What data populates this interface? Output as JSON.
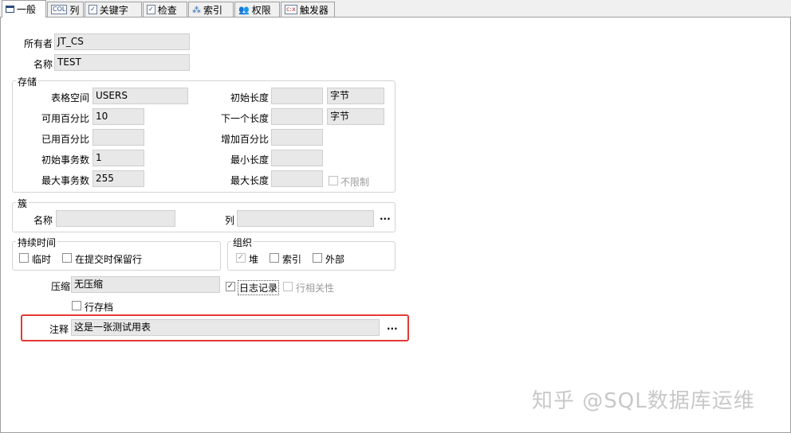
{
  "tabs": [
    {
      "label": "一般",
      "icon": "window-icon"
    },
    {
      "label": "列",
      "icon": "columns-icon"
    },
    {
      "label": "关键字",
      "icon": "key-icon"
    },
    {
      "label": "检查",
      "icon": "check-icon"
    },
    {
      "label": "索引",
      "icon": "index-icon"
    },
    {
      "label": "权限",
      "icon": "users-icon"
    },
    {
      "label": "触发器",
      "icon": "trigger-icon"
    }
  ],
  "icon_glyphs": {
    "columns": "COL",
    "check": "✓",
    "key": "✓",
    "trigger": "c:x"
  },
  "owner": {
    "label": "所有者",
    "value": "JT_CS"
  },
  "name": {
    "label": "名称",
    "value": "TEST"
  },
  "storage": {
    "title": "存储",
    "tablespace": {
      "label": "表格空间",
      "value": "USERS"
    },
    "pct_free": {
      "label": "可用百分比",
      "value": "10"
    },
    "pct_used": {
      "label": "已用百分比",
      "value": ""
    },
    "ini_trans": {
      "label": "初始事务数",
      "value": "1"
    },
    "max_trans": {
      "label": "最大事务数",
      "value": "255"
    },
    "initial": {
      "label": "初始长度",
      "value": "",
      "unit": "字节"
    },
    "next": {
      "label": "下一个长度",
      "value": "",
      "unit": "字节"
    },
    "pct_increase": {
      "label": "增加百分比",
      "value": ""
    },
    "min_extents": {
      "label": "最小长度",
      "value": ""
    },
    "max_extents": {
      "label": "最大长度",
      "value": ""
    },
    "unlimited": {
      "label": "不限制",
      "checked": false,
      "disabled": true
    }
  },
  "cluster": {
    "title": "簇",
    "name": {
      "label": "名称",
      "value": ""
    },
    "columns": {
      "label": "列",
      "value": ""
    },
    "browse": "..."
  },
  "duration": {
    "title": "持续时间",
    "temporary": {
      "label": "临时",
      "checked": false
    },
    "preserve_rows": {
      "label": "在提交时保留行",
      "checked": false
    }
  },
  "organization": {
    "title": "组织",
    "heap": {
      "label": "堆",
      "checked": true,
      "disabled": true
    },
    "index": {
      "label": "索引",
      "checked": false
    },
    "external": {
      "label": "外部",
      "checked": false
    }
  },
  "compression": {
    "label": "压缩",
    "value": "无压缩"
  },
  "logging": {
    "label": "日志记录",
    "checked": true
  },
  "row_dependencies": {
    "label": "行相关性",
    "checked": false,
    "disabled": true
  },
  "row_archival": {
    "label": "行存档",
    "checked": false
  },
  "comment": {
    "label": "注释",
    "value": "这是一张测试用表",
    "browse": "..."
  },
  "watermark": "知乎 @SQL数据库运维",
  "colors": {
    "highlight": "#e53935"
  }
}
